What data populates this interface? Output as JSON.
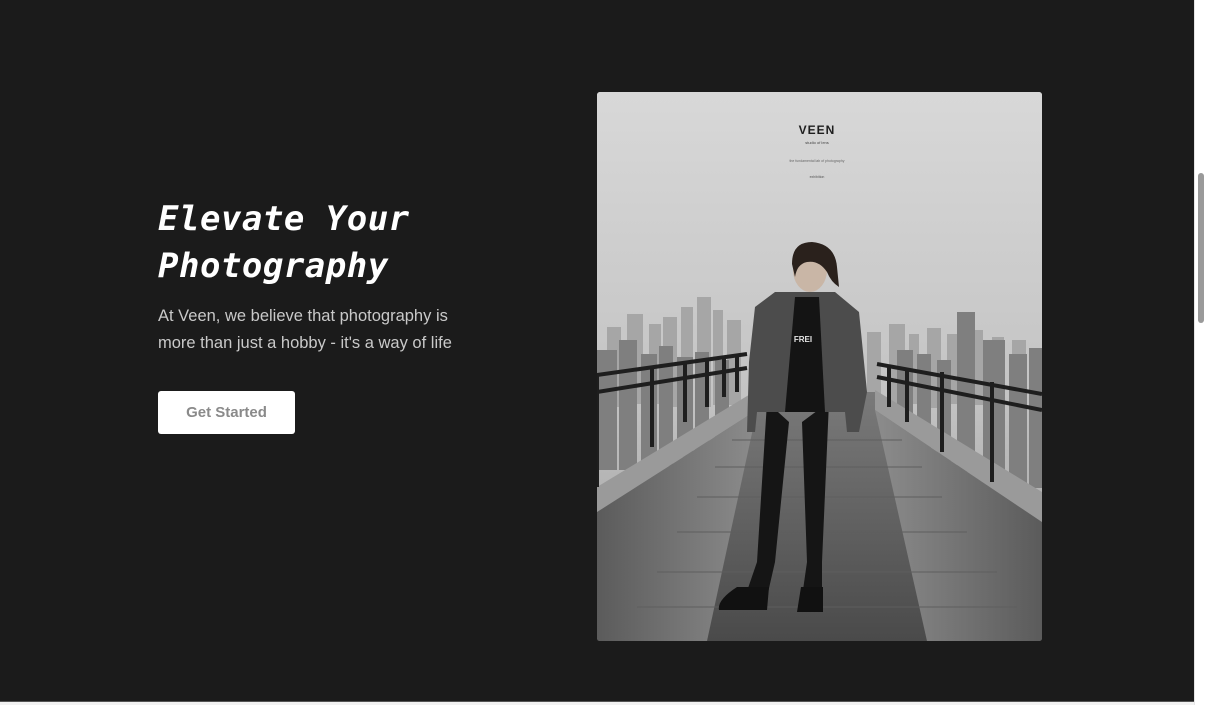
{
  "hero": {
    "title": "Elevate Your\nPhotography",
    "description": "At Veen, we believe that photography is more than just a hobby - it's a way of life",
    "cta_label": "Get Started"
  },
  "photo": {
    "brand": "VEEN",
    "subtitle": "studio of lens",
    "caption_line": "the fundamental lab of photography",
    "caption_small": "exhibition"
  },
  "colors": {
    "background": "#1b1b1b",
    "title": "#ffffff",
    "body_text": "#c9c9c9",
    "button_bg": "#ffffff",
    "button_text": "#8a8a8a"
  }
}
